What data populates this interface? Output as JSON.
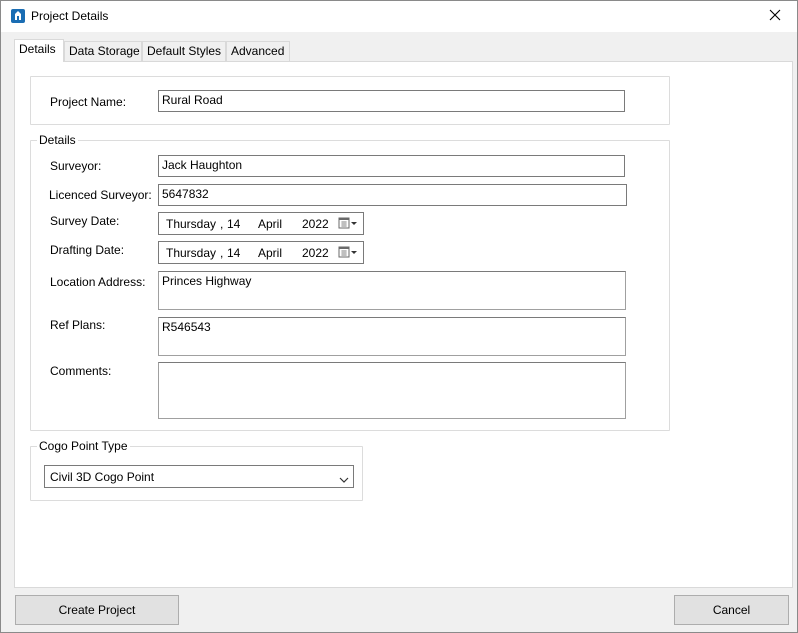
{
  "window": {
    "title": "Project Details"
  },
  "tabs": [
    "Details",
    "Data Storage",
    "Default Styles",
    "Advanced"
  ],
  "project": {
    "name_label": "Project Name:",
    "name_value": "Rural Road"
  },
  "details": {
    "legend": "Details",
    "surveyor_label": "Surveyor:",
    "surveyor_value": "Jack Haughton",
    "licenced_label": "Licenced Surveyor:",
    "licenced_value": "5647832",
    "survey_date_label": "Survey Date:",
    "survey_date": {
      "weekday": "Thursday",
      "sep": ",",
      "day": "14",
      "month": "April",
      "year": "2022"
    },
    "drafting_date_label": "Drafting Date:",
    "drafting_date": {
      "weekday": "Thursday",
      "sep": ",",
      "day": "14",
      "month": "April",
      "year": "2022"
    },
    "location_label": "Location Address:",
    "location_value": "Princes Highway",
    "ref_plans_label": "Ref Plans:",
    "ref_plans_value": "R546543",
    "comments_label": "Comments:",
    "comments_value": ""
  },
  "cogo": {
    "legend": "Cogo Point Type",
    "selected": "Civil 3D Cogo Point"
  },
  "buttons": {
    "create": "Create Project",
    "cancel": "Cancel"
  },
  "icons": {
    "app": "app-icon",
    "close": "close-icon",
    "calendar": "calendar-icon",
    "dropdown": "chevron-down-icon"
  },
  "colors": {
    "app_icon": "#1a6db3",
    "window_bg": "#f0f0f0",
    "panel_bg": "#ffffff"
  }
}
